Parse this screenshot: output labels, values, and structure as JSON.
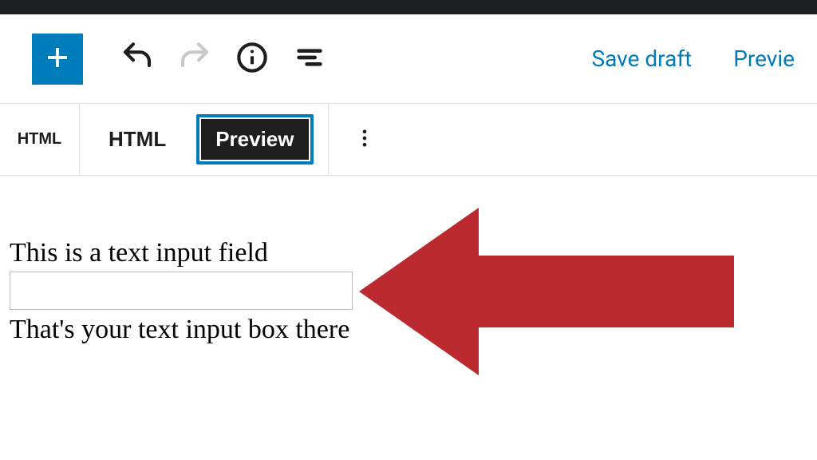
{
  "header": {
    "save_draft_label": "Save draft",
    "preview_label": "Previe"
  },
  "block_toolbar": {
    "block_type_short": "HTML",
    "tab_html_label": "HTML",
    "tab_preview_label": "Preview"
  },
  "content": {
    "label_above": "This is a text input field",
    "input_value": "",
    "label_below": "That's your text input box there"
  },
  "colors": {
    "accent": "#007cba",
    "arrow": "#bb2a2f"
  }
}
